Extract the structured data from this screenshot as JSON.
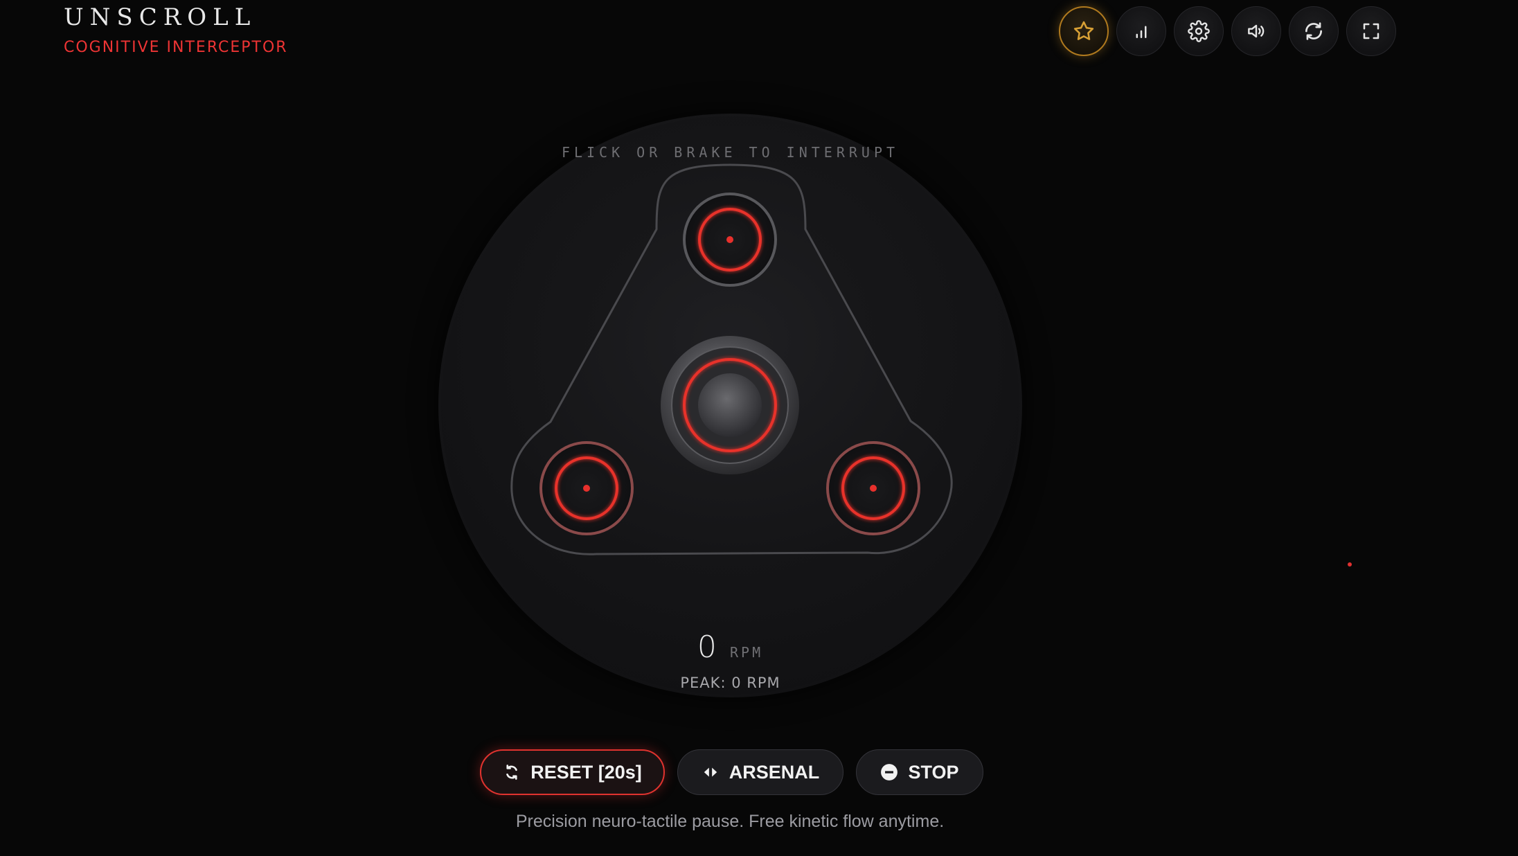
{
  "brand": {
    "title": "UNSCROLL",
    "subtitle": "COGNITIVE INTERCEPTOR"
  },
  "toolbar": {
    "items": [
      {
        "icon": "star-icon",
        "active": true
      },
      {
        "icon": "bar-chart-icon",
        "active": false
      },
      {
        "icon": "gear-icon",
        "active": false
      },
      {
        "icon": "volume-icon",
        "active": false
      },
      {
        "icon": "refresh-icon",
        "active": false
      },
      {
        "icon": "fullscreen-icon",
        "active": false
      }
    ]
  },
  "spinner": {
    "hint": "FLICK OR BRAKE TO INTERRUPT",
    "rpm_value": "0",
    "rpm_unit": "RPM",
    "peak": "PEAK: 0 RPM",
    "accent_color": "#e8302c"
  },
  "actions": {
    "reset_label": "RESET [20s]",
    "arsenal_label": "ARSENAL",
    "stop_label": "STOP"
  },
  "footer": {
    "text": "Precision neuro-tactile pause. Free kinetic flow anytime."
  },
  "colors": {
    "background": "#070707",
    "accent_red": "#e8302c",
    "accent_gold": "#d8a035"
  }
}
